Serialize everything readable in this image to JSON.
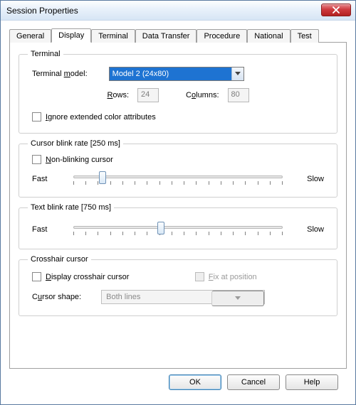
{
  "window": {
    "title": "Session Properties"
  },
  "tabs": [
    "General",
    "Display",
    "Terminal",
    "Data Transfer",
    "Procedure",
    "National",
    "Test"
  ],
  "active_tab_index": 1,
  "terminal": {
    "legend": "Terminal",
    "model_label": "Terminal model:",
    "model_value": "Model 2 (24x80)",
    "rows_label": "Rows:",
    "rows_value": "24",
    "cols_label": "Columns:",
    "cols_value": "80",
    "ignore_ext_label": "Ignore extended color attributes",
    "ignore_ext_checked": false
  },
  "cursor_blink": {
    "legend": "Cursor blink rate [250 ms]",
    "nonblink_label": "Non-blinking cursor",
    "nonblink_checked": false,
    "fast": "Fast",
    "slow": "Slow",
    "pos_percent": 14
  },
  "text_blink": {
    "legend": "Text blink rate [750 ms]",
    "fast": "Fast",
    "slow": "Slow",
    "pos_percent": 42
  },
  "crosshair": {
    "legend": "Crosshair cursor",
    "display_label": "Display crosshair cursor",
    "display_checked": false,
    "fix_label": "Fix at position",
    "fix_enabled": false,
    "shape_label": "Cursor shape:",
    "shape_value": "Both lines",
    "shape_enabled": false
  },
  "buttons": {
    "ok": "OK",
    "cancel": "Cancel",
    "help": "Help"
  }
}
